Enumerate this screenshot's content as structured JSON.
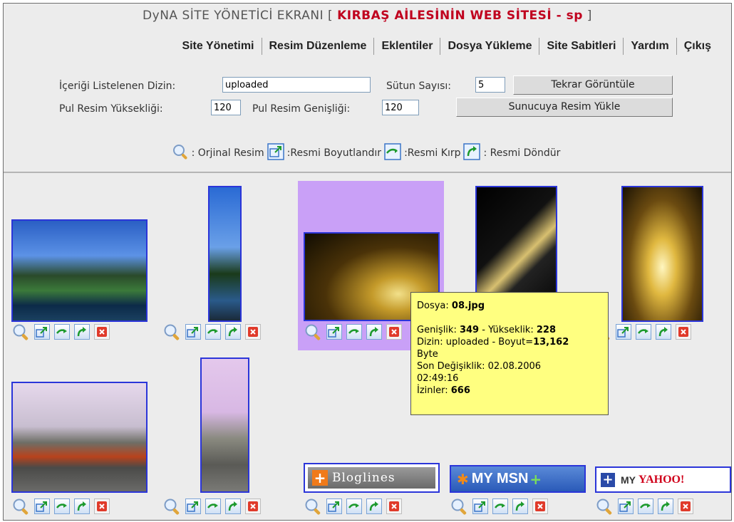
{
  "title": {
    "prefix": "DyNA SİTE YÖNETİCİ EKRANI [ ",
    "site": "KIRBAŞ AİLESİNİN WEB SİTESİ - sp",
    "suffix": " ]"
  },
  "menu": [
    "Site Yönetimi",
    "Resim Düzenleme",
    "Eklentiler",
    "Dosya Yükleme",
    "Site Sabitleri",
    "Yardım",
    "Çıkış"
  ],
  "form": {
    "dir_label": "İçeriği Listelenen Dizin:",
    "dir_value": "uploaded",
    "cols_label": "Sütun Sayısı:",
    "cols_value": "5",
    "refresh_button": "Tekrar Görüntüle",
    "thumb_h_label": "Pul Resim Yüksekliği:",
    "thumb_h_value": "120",
    "thumb_w_label": "Pul Resim Genişliği:",
    "thumb_w_value": "120",
    "upload_button": "Sunucuya Resim Yükle"
  },
  "legend": {
    "original": ": Orjinal Resim",
    "resize": ":Resmi Boyutlandır",
    "crop": ":Resmi Kırp",
    "rotate": ": Resmi Döndür"
  },
  "tooltip": {
    "file_label": "Dosya:",
    "file_value": "08.jpg",
    "width_label": "Genişlik:",
    "width_value": "349",
    "height_sep": " - Yükseklik:",
    "height_value": "228",
    "dir_text": "Dizin: uploaded - Boyut=",
    "size_value": "13,162",
    "byte": "Byte",
    "modified": "Son Değişiklik: 02.08.2006",
    "time": "02:49:16",
    "perm_label": "İzinler:",
    "perm_value": "666"
  },
  "banners": {
    "bloglines": "Bloglines",
    "msn": "MY MSN",
    "yahoo_my": "MY",
    "yahoo": "YAHOO!"
  },
  "colors": {
    "accent": "#c0001e",
    "thumb_border": "#2b35d9",
    "selected": "#c9a0f7",
    "tooltip": "#ffff80"
  }
}
